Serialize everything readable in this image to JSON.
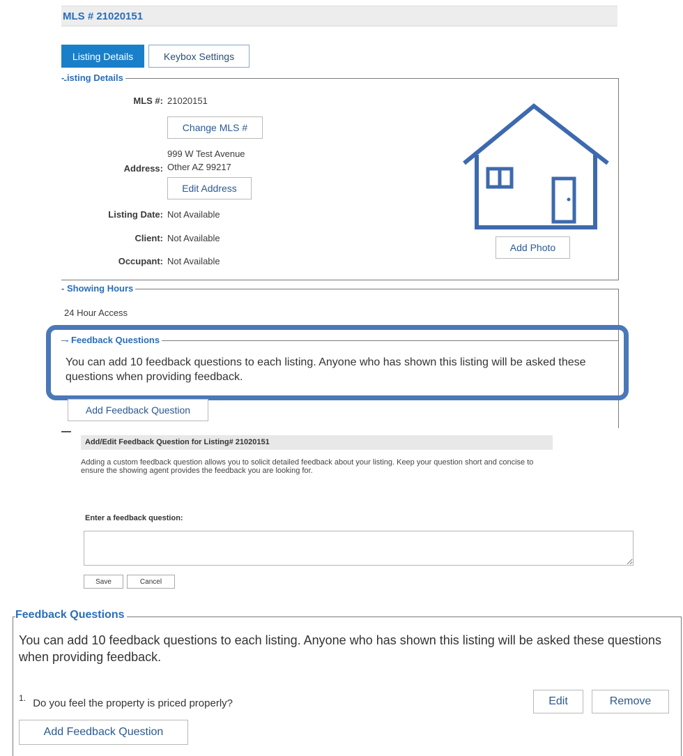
{
  "header": {
    "title": "MLS # 21020151"
  },
  "tabs": [
    {
      "label": "Listing Details",
      "active": true
    },
    {
      "label": "Keybox Settings",
      "active": false
    }
  ],
  "listing_details": {
    "legend": "Listing Details",
    "mls_label": "MLS #:",
    "mls_value": "21020151",
    "change_mls_button": "Change MLS #",
    "address_label": "Address:",
    "address_line1": "999 W Test Avenue",
    "address_line2": "Other AZ 99217",
    "edit_address_button": "Edit Address",
    "listing_date_label": "Listing Date:",
    "listing_date_value": "Not Available",
    "client_label": "Client:",
    "client_value": "Not Available",
    "occupant_label": "Occupant:",
    "occupant_value": "Not Available",
    "add_photo_button": "Add Photo",
    "photo_icon": "house-icon"
  },
  "showing_hours": {
    "legend": "Showing Hours",
    "value": "24 Hour Access"
  },
  "feedback_questions": {
    "legend": "Feedback Questions",
    "description": "You can add 10 feedback questions to each listing. Anyone who has shown this listing will be asked these questions when providing feedback.",
    "add_button": "Add Feedback Question"
  },
  "edit_dialog": {
    "header": "Add/Edit Feedback Question for Listing# 21020151",
    "description": "Adding a custom feedback question allows you to solicit detailed feedback about your listing. Keep your question short and concise to ensure the showing agent provides the feedback you are looking for.",
    "input_label": "Enter a feedback question:",
    "input_value": "",
    "save_button": "Save",
    "cancel_button": "Cancel"
  },
  "feedback_questions_result": {
    "legend": "Feedback Questions",
    "description": "You can add 10 feedback questions to each listing. Anyone who has shown this listing will be asked these questions when providing feedback.",
    "questions": [
      {
        "number": "1.",
        "text": "Do you feel the property is priced properly?",
        "edit_label": "Edit",
        "remove_label": "Remove"
      }
    ],
    "add_button": "Add Feedback Question"
  },
  "colors": {
    "accent": "#2a6ebb",
    "active_tab": "#1a7fc9",
    "highlight": "#4a78b8",
    "house_icon": "#3d6aae"
  }
}
